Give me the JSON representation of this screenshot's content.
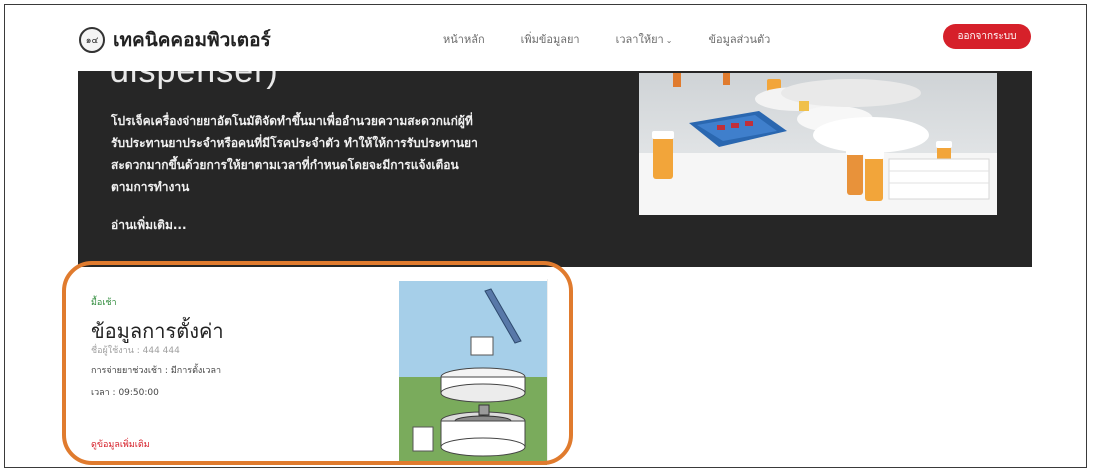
{
  "navbar": {
    "brand_logo_text": "๑๔",
    "brand_name": "เทคนิคคอมพิวเตอร์",
    "links": [
      {
        "label": "หน้าหลัก"
      },
      {
        "label": "เพิ่มข้อมูลยา"
      },
      {
        "label": "เวลาให้ยา"
      },
      {
        "label": "ข้อมูลส่วนตัว"
      }
    ],
    "dropdown_caret": "⌄",
    "logout_label": "ออกจากระบบ"
  },
  "hero": {
    "title": "dispenser)",
    "description": "โปรเจ็คเครื่องจ่ายยาอัตโนมัติจัดทำขึ้นมาเพื่ออำนวยความสะดวกแก่ผู้ที่รับประทานยาประจำหรือคนที่มีโรคประจำตัว ทำให้ให้การรับประทานยาสะดวกมากขึ้นด้วยการให้ยาตามเวลาที่กำหนดโดยจะมีการแจ้งเตือนตามการทำงาน",
    "read_more": "อ่านเพิ่มเติม..."
  },
  "card": {
    "category": "มื้อเช้า",
    "title": "ข้อมูลการตั้งค่า",
    "user": "ชื่อผู้ใช้งาน : 444 444",
    "mode": "การจ่ายยาช่วงเช้า : มีการตั้งเวลา",
    "time": "เวลา : 09:50:00",
    "more_link": "ดูข้อมูลเพิ่มเติม"
  },
  "colors": {
    "accent_red": "#d6202a",
    "hero_bg": "#262626",
    "highlight_orange": "#e07b2e",
    "category_green": "#2e8b3a"
  }
}
